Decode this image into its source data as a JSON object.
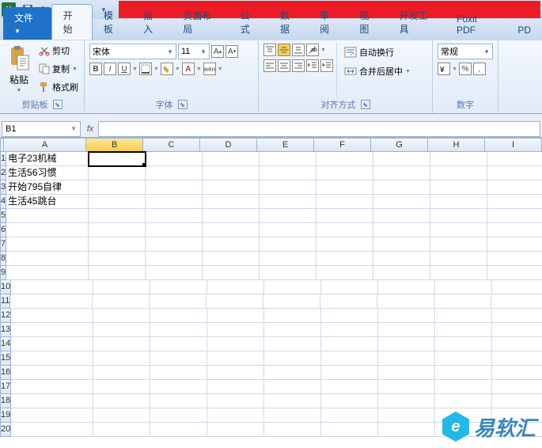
{
  "qat": {
    "save": "保存",
    "undo": "撤销",
    "redo": "重做"
  },
  "tabs": {
    "file": "文件",
    "home": "开始",
    "templates": "模板",
    "insert": "插入",
    "pagelayout": "页面布局",
    "formulas": "公式",
    "data": "数据",
    "review": "审阅",
    "view": "视图",
    "developer": "开发工具",
    "foxit": "Foxit PDF",
    "pd": "PD"
  },
  "ribbon": {
    "clipboard": {
      "paste": "粘贴",
      "cut": "剪切",
      "copy": "复制",
      "painter": "格式刷",
      "label": "剪贴板"
    },
    "font": {
      "name": "宋体",
      "size": "11",
      "bold": "B",
      "italic": "I",
      "underline": "U",
      "label": "字体",
      "phonetic": "wén"
    },
    "align": {
      "wrap": "自动换行",
      "merge": "合并后居中",
      "label": "对齐方式"
    },
    "number": {
      "general": "常规",
      "label": "数字",
      "percent": "%",
      "comma": ","
    }
  },
  "namebox": "B1",
  "columns": [
    "A",
    "B",
    "C",
    "D",
    "E",
    "F",
    "G",
    "H",
    "I"
  ],
  "rows": [
    1,
    2,
    3,
    4,
    5,
    6,
    7,
    8,
    9,
    10,
    11,
    12,
    13,
    14,
    15,
    16,
    17,
    18,
    19,
    20
  ],
  "cells": {
    "A1": "电子23机械",
    "A2": "生活56习惯",
    "A3": "开始795自律",
    "A4": "生活45跳台"
  },
  "active": "B1",
  "watermark": "易软汇"
}
